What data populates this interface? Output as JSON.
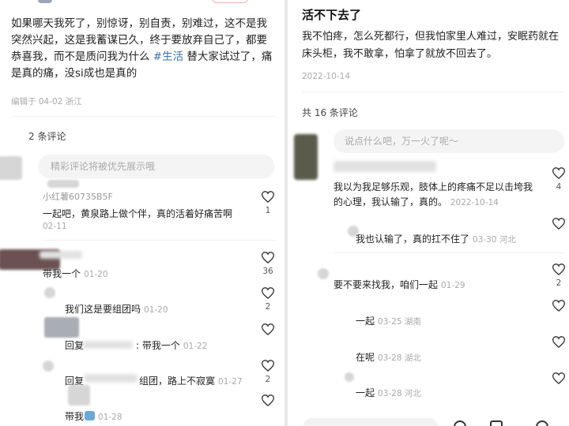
{
  "left": {
    "post_text_1": "如果哪天我死了，别惊讶，别自责，别难过，这不是我突然兴起，这是我蓄谋已久，终于要放弃自己了，都要恭喜我，而不是质问我为什么",
    "post_tag": "#生活",
    "post_text_2": "替大家试过了，痛是真的痛，没si成也是真的",
    "edited": "编辑于 04-02 浙江",
    "comment_count": "2 条评论",
    "input_placeholder": "精彩评论将被优先展示哦",
    "comments": [
      {
        "user": "小红薯60735B5F",
        "text": "一起吧，黄泉路上做个伴，真的活着好痛苦啊",
        "date": "02-11",
        "likes": "1"
      },
      {
        "user": "",
        "text": "带我一个",
        "date": "01-20",
        "likes": "36"
      },
      {
        "user": "",
        "text": "我们这是要组团吗",
        "date": "01-20",
        "likes": "2"
      },
      {
        "user": "",
        "text": "回复",
        "text_2": ": 带我一个",
        "date": "01-22",
        "likes": ""
      },
      {
        "user": "",
        "text": "回复",
        "text_2": "组团，路上不寂寞",
        "date": "01-27",
        "likes": "2"
      },
      {
        "user": "",
        "text": "带我",
        "date": "01-28",
        "likes": ""
      }
    ]
  },
  "right": {
    "title": "活不下去了",
    "post_text": "我不怕疼，怎么死都行，但我怕家里人难过，安眠药就在床头柜，我不敢拿，怕拿了就放不回去了。",
    "post_date": "2022-10-14",
    "comment_count": "共 16 条评论",
    "input_placeholder": "说点什么吧，万一火了呢～",
    "comments": [
      {
        "text": "我以为我足够乐观，肢体上的疼痛不足以击垮我的心理，我认输了，真的。",
        "date": "2022-10-14",
        "likes": "4"
      },
      {
        "text": "我也认输了，真的扛不住了",
        "date": "03-30 河北",
        "likes": ""
      },
      {
        "text": "要不要来找我，咱们一起",
        "date": "01-29",
        "likes": "2"
      },
      {
        "text": "一起",
        "date": "03-25 湖南",
        "likes": ""
      },
      {
        "text": "在呢",
        "date": "03-28 湖北",
        "likes": ""
      },
      {
        "text": "一起",
        "date": "03-28 河北",
        "likes": ""
      }
    ]
  }
}
